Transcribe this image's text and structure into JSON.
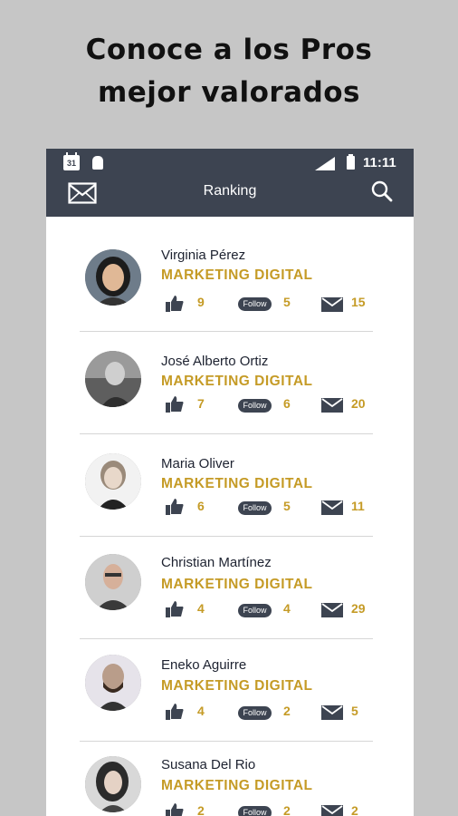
{
  "headline": {
    "line1": "Conoce a los Pros",
    "line2": "mejor valorados"
  },
  "status_bar": {
    "calendar_day": "31",
    "time": "11:11"
  },
  "app_bar": {
    "title": "Ranking",
    "icons": [
      "mail-icon",
      "search-icon"
    ]
  },
  "follow_badge_label": "Follow",
  "colors": {
    "header_bg": "#3d4451",
    "accent_gold": "#c59b26",
    "page_bg": "#c6c6c6"
  },
  "ranking": [
    {
      "name": "Virginia Pérez",
      "category": "MARKETING DIGITAL",
      "likes": "9",
      "follows": "5",
      "messages": "15"
    },
    {
      "name": "José Alberto Ortiz",
      "category": "MARKETING DIGITAL",
      "likes": "7",
      "follows": "6",
      "messages": "20"
    },
    {
      "name": "Maria Oliver",
      "category": "MARKETING DIGITAL",
      "likes": "6",
      "follows": "5",
      "messages": "11"
    },
    {
      "name": "Christian Martínez",
      "category": "MARKETING DIGITAL",
      "likes": "4",
      "follows": "4",
      "messages": "29"
    },
    {
      "name": "Eneko Aguirre",
      "category": "MARKETING DIGITAL",
      "likes": "4",
      "follows": "2",
      "messages": "5"
    },
    {
      "name": "Susana Del Rio",
      "category": "MARKETING DIGITAL",
      "likes": "2",
      "follows": "2",
      "messages": "2"
    }
  ]
}
